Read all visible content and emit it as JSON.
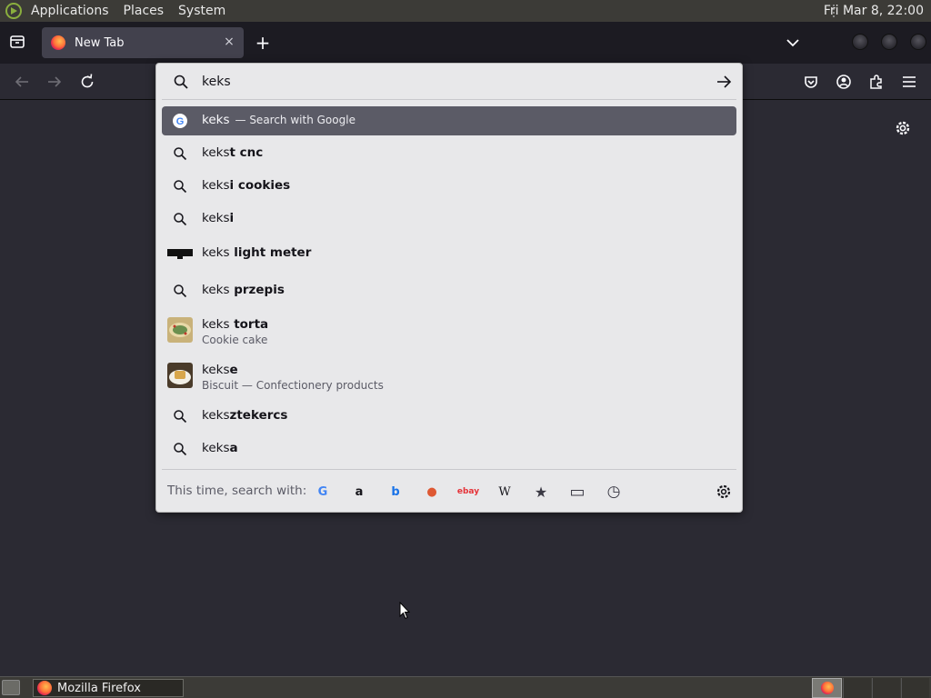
{
  "system_panel": {
    "menus": [
      "Applications",
      "Places",
      "System"
    ],
    "clock": "Fri Mar  8, 22:00"
  },
  "browser": {
    "active_tab": {
      "title": "New Tab",
      "close_glyph": "×"
    },
    "new_tab_glyph": "+"
  },
  "urlbar": {
    "value": "keks",
    "results": [
      {
        "icon": "google-icon",
        "typed": "keks",
        "completion": "",
        "action": "— Search with Google",
        "selected": true
      },
      {
        "icon": "search-icon",
        "typed": "keks",
        "completion": "t cnc"
      },
      {
        "icon": "search-icon",
        "typed": "keks",
        "completion": "i cookies"
      },
      {
        "icon": "search-icon",
        "typed": "keks",
        "completion": "i"
      },
      {
        "icon": "tv-icon",
        "typed": "keks",
        "completion": " light meter"
      },
      {
        "icon": "search-icon",
        "typed": "keks",
        "completion": " przepis"
      },
      {
        "icon": "thumbnail",
        "typed": "keks",
        "completion": " torta",
        "subtitle": "Cookie cake"
      },
      {
        "icon": "thumbnail",
        "typed": "keks",
        "completion": "e",
        "subtitle": "Biscuit — Confectionery products"
      },
      {
        "icon": "search-icon",
        "typed": "keks",
        "completion": "ztekercs"
      },
      {
        "icon": "search-icon",
        "typed": "keks",
        "completion": "a"
      }
    ],
    "oneoff_label": "This time, search with:",
    "engines": [
      {
        "name": "google-icon",
        "glyph": "G",
        "color": "#4285f4"
      },
      {
        "name": "amazon-icon",
        "glyph": "a",
        "color": "#15141a"
      },
      {
        "name": "bing-icon",
        "glyph": "b",
        "color": "#1a73e8"
      },
      {
        "name": "duckduckgo-icon",
        "glyph": "●",
        "color": "#de5833"
      },
      {
        "name": "ebay-icon",
        "glyph": "ebay",
        "color": "#e53238"
      },
      {
        "name": "wikipedia-icon",
        "glyph": "W",
        "color": "#15141a"
      },
      {
        "name": "bookmarks-icon",
        "glyph": "★",
        "color": "#3a3944"
      },
      {
        "name": "tabs-icon",
        "glyph": "▭",
        "color": "#3a3944"
      },
      {
        "name": "history-icon",
        "glyph": "◷",
        "color": "#3a3944"
      }
    ]
  },
  "taskbar": {
    "window_title": "Mozilla Firefox"
  }
}
